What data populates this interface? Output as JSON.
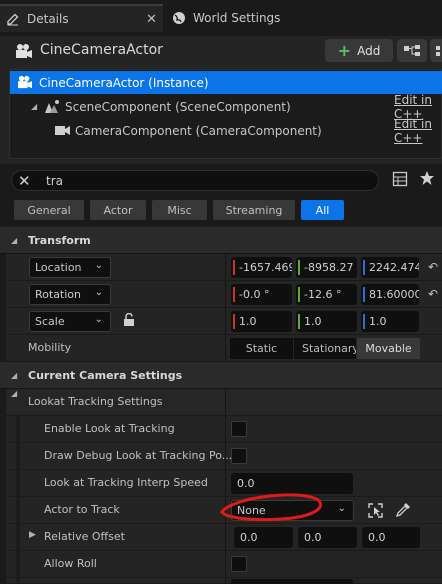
{
  "tabs": [
    {
      "label": "Details",
      "icon": "pencil-icon",
      "active": true
    },
    {
      "label": "World Settings",
      "icon": "globe-icon",
      "active": false
    }
  ],
  "header": {
    "actor_name": "CineCameraActor",
    "add_label": "Add"
  },
  "tree": [
    {
      "label": "CineCameraActor (Instance)",
      "selected": true
    },
    {
      "label": "SceneComponent (SceneComponent)",
      "edit": "Edit in C++"
    },
    {
      "label": "CameraComponent (CameraComponent)",
      "edit": "Edit in C++"
    }
  ],
  "search": {
    "value": "tra"
  },
  "filters": [
    "General",
    "Actor",
    "Misc",
    "Streaming",
    "All"
  ],
  "active_filter": "All",
  "transform": {
    "category": "Transform",
    "location": {
      "label": "Location",
      "x": "-1657.469",
      "y": "-8958.27",
      "z": "2242.474"
    },
    "rotation": {
      "label": "Rotation",
      "x": "-0.0 °",
      "y": "-12.6 °",
      "z": "81.60000"
    },
    "scale": {
      "label": "Scale",
      "x": "1.0",
      "y": "1.0",
      "z": "1.0"
    },
    "mobility": {
      "label": "Mobility",
      "options": [
        "Static",
        "Stationary",
        "Movable"
      ],
      "selected": "Movable"
    }
  },
  "camera": {
    "category": "Current Camera Settings",
    "lookat": {
      "label": "Lookat Tracking Settings",
      "enable": "Enable Look at Tracking",
      "debug": "Draw Debug Look at Tracking Po...",
      "speed_label": "Look at Tracking Interp Speed",
      "speed_value": "0.0",
      "actor_label": "Actor to Track",
      "actor_value": "None",
      "offset_label": "Relative Offset",
      "offset": [
        "0.0",
        "0.0",
        "0.0"
      ],
      "roll_label": "Allow Roll"
    }
  },
  "colors": {
    "accent": "#0b74e6",
    "x_axis": "#c9372c",
    "y_axis": "#5fa83c",
    "z_axis": "#2e6fd1",
    "annotation": "#e01a1a"
  }
}
